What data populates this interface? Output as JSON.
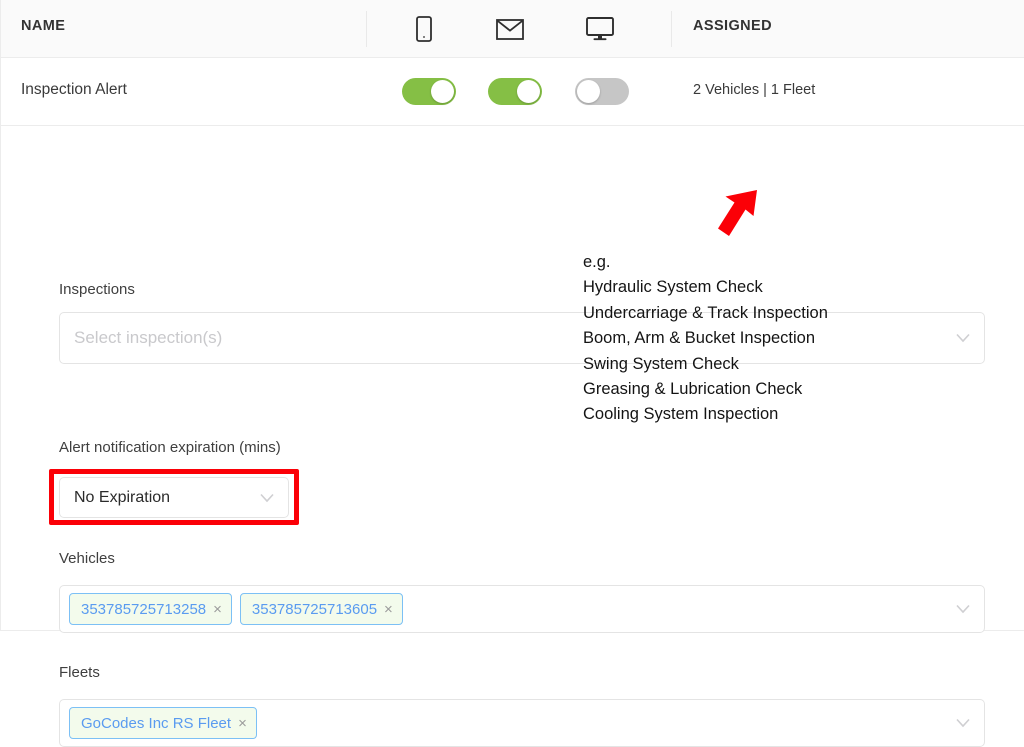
{
  "table": {
    "columns": {
      "name_label": "NAME",
      "assigned_label": "ASSIGNED",
      "mobile_icon": "mobile-phone-icon",
      "email_icon": "envelope-icon",
      "desktop_icon": "desktop-monitor-icon"
    },
    "row": {
      "name": "Inspection Alert",
      "assigned": "2 Vehicles | 1 Fleet",
      "toggles": [
        {
          "name": "mobile-notification-toggle",
          "state": "on"
        },
        {
          "name": "email-notification-toggle",
          "state": "on"
        },
        {
          "name": "desktop-notification-toggle",
          "state": "off"
        }
      ]
    }
  },
  "form": {
    "inspections": {
      "label": "Inspections",
      "placeholder": "Select inspection(s)",
      "value": ""
    },
    "expiration": {
      "label": "Alert notification expiration (mins)",
      "value": "No Expiration"
    },
    "vehicles": {
      "label": "Vehicles",
      "chips": [
        "353785725713258",
        "353785725713605"
      ],
      "remove_glyph": "×"
    },
    "fleets": {
      "label": "Fleets",
      "chips": [
        "GoCodes Inc RS Fleet"
      ],
      "remove_glyph": "×"
    }
  },
  "annotation": {
    "lines": [
      "e.g.",
      "Hydraulic System Check",
      "Undercarriage & Track Inspection",
      "Boom, Arm & Bucket Inspection",
      "Swing System Check",
      "Greasing & Lubrication Check",
      "Cooling System Inspection"
    ],
    "arrow": "red-arrow-pointing-up-right"
  },
  "colors": {
    "toggle_on": "#85bf45",
    "toggle_off": "#c6c6c6",
    "highlight": "#fb0007",
    "chip_text": "#5a9bf0",
    "chip_border": "#7cc0f5",
    "chip_bg": "#f3fbec"
  }
}
